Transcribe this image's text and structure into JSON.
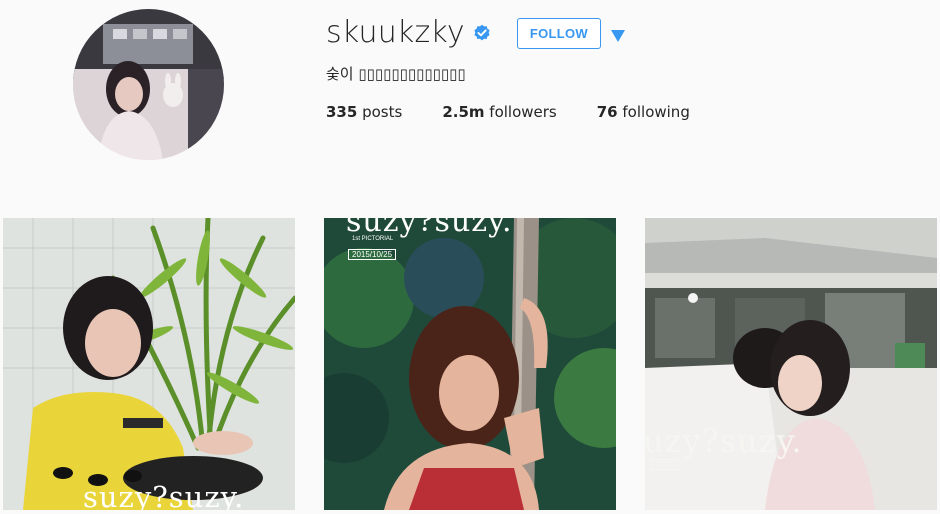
{
  "profile": {
    "username": "skuukzky",
    "verified": true,
    "follow_label": "FOLLOW",
    "bio": "숮이 ▯▯▯▯▯▯▯▯▯▯▯▯▯",
    "stats": {
      "posts_value": "335",
      "posts_label": "posts",
      "followers_value": "2.5m",
      "followers_label": "followers",
      "following_value": "76",
      "following_label": "following"
    }
  },
  "posts": [
    {
      "overlay_text": "suzy?suzy."
    },
    {
      "overlay_title": "suzy?suzy.",
      "overlay_subtitle": "1st PICTORIAL",
      "overlay_date": "2015/10/25"
    },
    {
      "overlay_text": "uzy?suzy.",
      "overlay_date": "10/25"
    }
  ],
  "colors": {
    "accent": "#3897f0",
    "text": "#262626",
    "background": "#fafafa"
  },
  "icons": [
    "verified-badge-icon",
    "dropdown-arrow-icon"
  ]
}
